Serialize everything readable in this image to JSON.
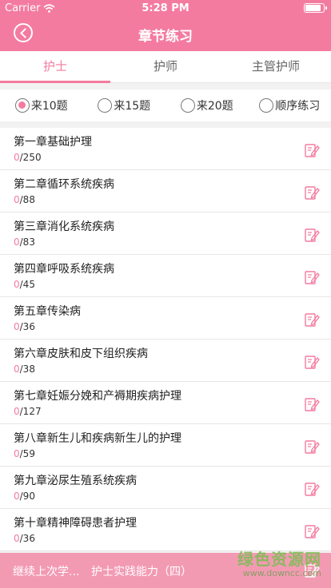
{
  "status_bar": {
    "carrier": "Carrier",
    "time": "5:28 PM"
  },
  "nav": {
    "title": "章节练习"
  },
  "tabs": [
    {
      "label": "护士",
      "active": true
    },
    {
      "label": "护师",
      "active": false
    },
    {
      "label": "主管护师",
      "active": false
    }
  ],
  "options": [
    {
      "label": "来10题",
      "checked": true
    },
    {
      "label": "来15题",
      "checked": false
    },
    {
      "label": "来20题",
      "checked": false
    },
    {
      "label": "顺序练习",
      "checked": false
    }
  ],
  "chapters": [
    {
      "name": "第一章基础护理",
      "done": "0",
      "total": "/250"
    },
    {
      "name": "第二章循环系统疾病",
      "done": "0",
      "total": "/88"
    },
    {
      "name": "第三章消化系统疾病",
      "done": "0",
      "total": "/83"
    },
    {
      "name": "第四章呼吸系统疾病",
      "done": "0",
      "total": "/45"
    },
    {
      "name": "第五章传染病",
      "done": "0",
      "total": "/36"
    },
    {
      "name": "第六章皮肤和皮下组织疾病",
      "done": "0",
      "total": "/38"
    },
    {
      "name": "第七章妊娠分娩和产褥期疾病护理",
      "done": "0",
      "total": "/127"
    },
    {
      "name": "第八章新生儿和疾病新生儿的护理",
      "done": "0",
      "total": "/59"
    },
    {
      "name": "第九章泌尿生殖系统疾病",
      "done": "0",
      "total": "/90"
    },
    {
      "name": "第十章精神障碍患者护理",
      "done": "0",
      "total": "/36"
    }
  ],
  "bottom": {
    "continue_label": "继续上次学...",
    "last_section": "护士实践能力（四）"
  },
  "watermark": {
    "text": "绿色资源网",
    "url": "www.downcc.com"
  },
  "colors": {
    "accent": "#f47ba0",
    "bottom_bar": "#f39ab3"
  },
  "icons": {
    "back": "back-circle-icon",
    "edit": "edit-note-icon",
    "wifi": "wifi-icon",
    "battery": "battery-icon"
  }
}
